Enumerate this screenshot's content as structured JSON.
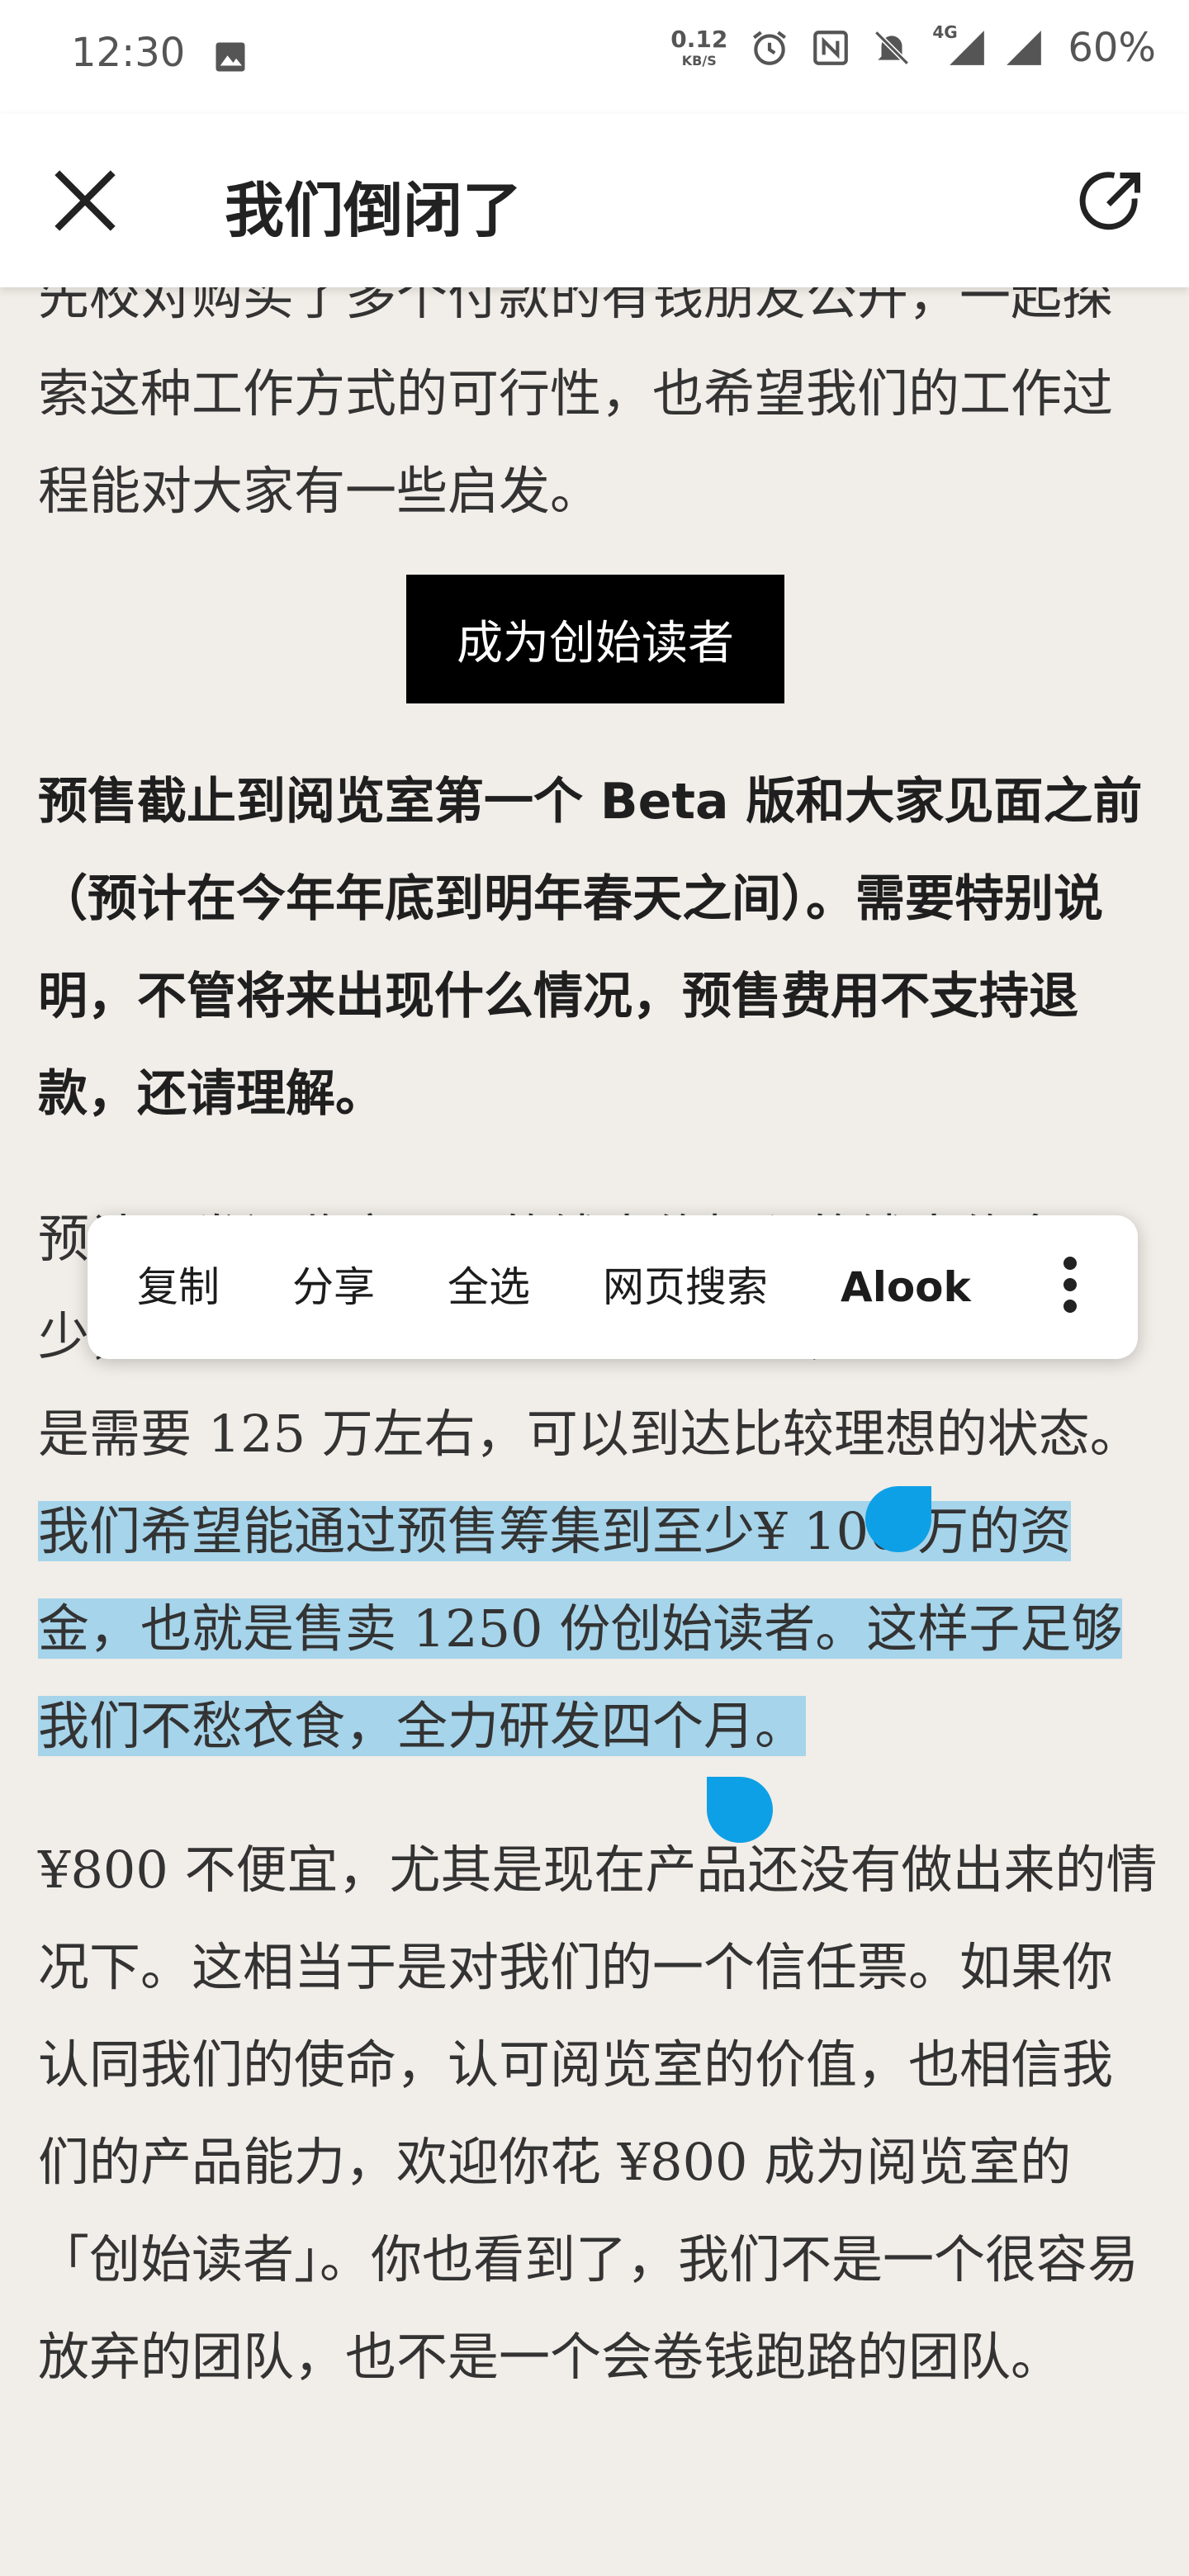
{
  "status_bar": {
    "time": "12:30",
    "net_speed_value": "0.12",
    "net_speed_unit": "KB/S",
    "battery": "60%",
    "network_label": "4G",
    "icons": [
      "photo-icon",
      "alarm-icon",
      "nfc-icon",
      "mute-icon",
      "signal-icon",
      "signal-icon"
    ]
  },
  "app_bar": {
    "title": "我们倒闭了"
  },
  "article": {
    "para1": "先校对购买了多个付款的有钱朋友公开，一起探索这种工作方式的可行性，也希望我们的工作过程能对大家有一些启发。",
    "cta_label": "成为创始读者",
    "bold_para": "预售截止到阅览室第一个 Beta 版和大家见面之前（预计在今年年底到明年春天之间）。需要特别说明，不管将来出现什么情况，预售费用不支持退款，还请理解。",
    "para3_plain": "预计研发阅览室需要的钱大约投入的钱大约多少，我们一直在核算这个开发成本，我们的估算是需要 125 万左右，可以到达比较理想的状态。",
    "para3_selected": "我们希望能通过预售筹集到至少¥ 100 万的资金，也就是售卖 1250 份创始读者。这样子足够我们不愁衣食，全力研发四个月。",
    "para4": "¥800 不便宜，尤其是现在产品还没有做出来的情况下。这相当于是对我们的一个信任票。如果你认同我们的使命，认可阅览室的价值，也相信我们的产品能力，欢迎你花 ¥800 成为阅览室的「创始读者」。你也看到了，我们不是一个很容易放弃的团队，也不是一个会卷钱跑路的团队。"
  },
  "context_menu": {
    "items": [
      "复制",
      "分享",
      "全选",
      "网页搜索",
      "Alook"
    ],
    "more_icon": "more-vert-icon"
  },
  "colors": {
    "page_bg": "#f1ede8",
    "selection": "#a6d4ea",
    "handle": "#0ea0e6",
    "cta_bg": "#000000"
  }
}
